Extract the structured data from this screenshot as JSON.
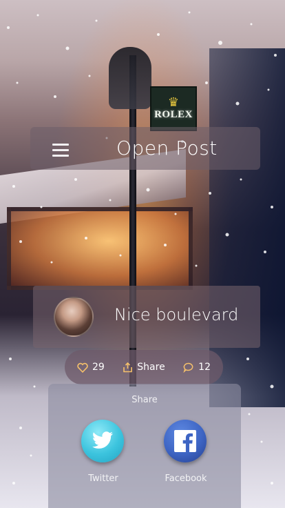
{
  "header": {
    "title": "Open Post"
  },
  "post": {
    "title": "Nice boulevard"
  },
  "background": {
    "sign_text": "ROLEX"
  },
  "stats": {
    "likes": "29",
    "share_label": "Share",
    "comments": "12"
  },
  "share_panel": {
    "title": "Share",
    "options": [
      {
        "label": "Twitter",
        "icon": "twitter-icon",
        "color": "#3cc4de"
      },
      {
        "label": "Facebook",
        "icon": "facebook-icon",
        "color": "#3d64c3"
      }
    ]
  }
}
